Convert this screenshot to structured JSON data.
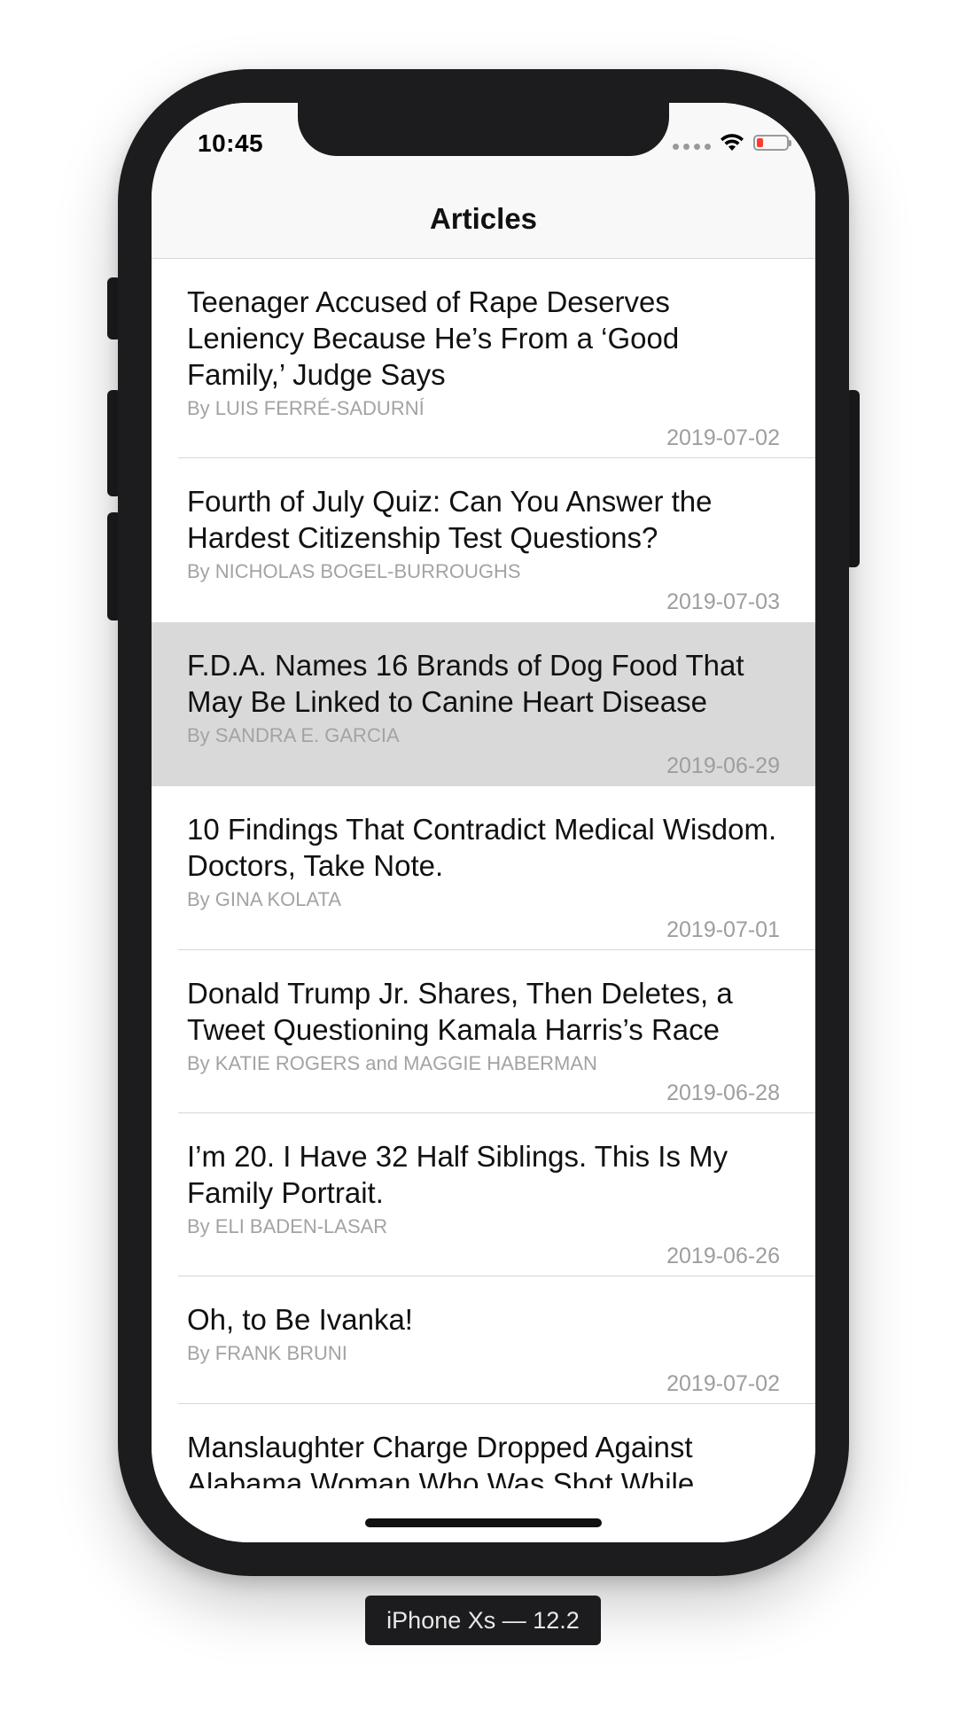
{
  "status_bar": {
    "time": "10:45"
  },
  "navbar": {
    "title": "Articles"
  },
  "articles": [
    {
      "title": "Teenager Accused of Rape Deserves Leniency Because He’s From a ‘Good Family,’ Judge Says",
      "author": "By LUIS FERRÉ-SADURNÍ",
      "date": "2019-07-02"
    },
    {
      "title": "Fourth of July Quiz: Can You Answer the Hardest Citizenship Test Questions?",
      "author": "By NICHOLAS BOGEL-BURROUGHS",
      "date": "2019-07-03"
    },
    {
      "title": "F.D.A. Names 16 Brands of Dog Food That May Be Linked to Canine Heart Disease",
      "author": "By SANDRA E. GARCIA",
      "date": "2019-06-29",
      "selected": true
    },
    {
      "title": "10 Findings That Contradict Medical Wisdom. Doctors, Take Note.",
      "author": "By GINA KOLATA",
      "date": "2019-07-01"
    },
    {
      "title": "Donald Trump Jr. Shares, Then Deletes, a Tweet Questioning Kamala Harris’s Race",
      "author": "By KATIE ROGERS and MAGGIE HABERMAN",
      "date": "2019-06-28"
    },
    {
      "title": "I’m 20. I Have 32 Half Siblings. This Is My Family Portrait.",
      "author": "By ELI BADEN-LASAR",
      "date": "2019-06-26"
    },
    {
      "title": "Oh, to Be Ivanka!",
      "author": "By FRANK BRUNI",
      "date": "2019-07-02"
    },
    {
      "title": "Manslaughter Charge Dropped Against Alabama Woman Who Was Shot While",
      "author": "",
      "date": ""
    }
  ],
  "device_label": "iPhone Xs — 12.2",
  "colors": {
    "device_frame": "#1c1c1e",
    "selected_row": "#d9d9d9",
    "secondary_text": "#a3a3a3",
    "battery_low": "#ff3b30"
  },
  "icons": [
    "signal-dots-icon",
    "wifi-icon",
    "battery-icon"
  ]
}
